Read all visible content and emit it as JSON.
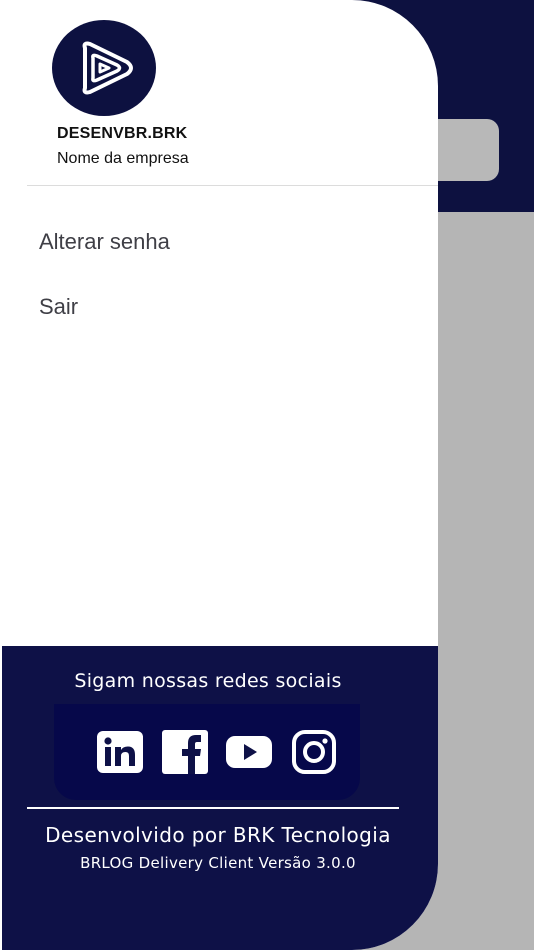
{
  "user": {
    "name": "DESENVBR.BRK",
    "company": "Nome da empresa"
  },
  "menu": {
    "items": [
      {
        "label": "Alterar senha"
      },
      {
        "label": "Sair"
      }
    ]
  },
  "footer": {
    "social_title": "Sigam nossas redes sociais",
    "social_icons": [
      "linkedin-icon",
      "facebook-icon",
      "youtube-icon",
      "instagram-icon"
    ],
    "developed_by": "Desenvolvido por BRK Tecnologia",
    "version": "BRLOG Delivery Client Versão 3.0.0"
  },
  "colors": {
    "brand_navy": "#0d1140",
    "footer_navy": "#0e1147",
    "overlay_gray": "#b5b5b5",
    "menu_text": "#3f3f46"
  }
}
